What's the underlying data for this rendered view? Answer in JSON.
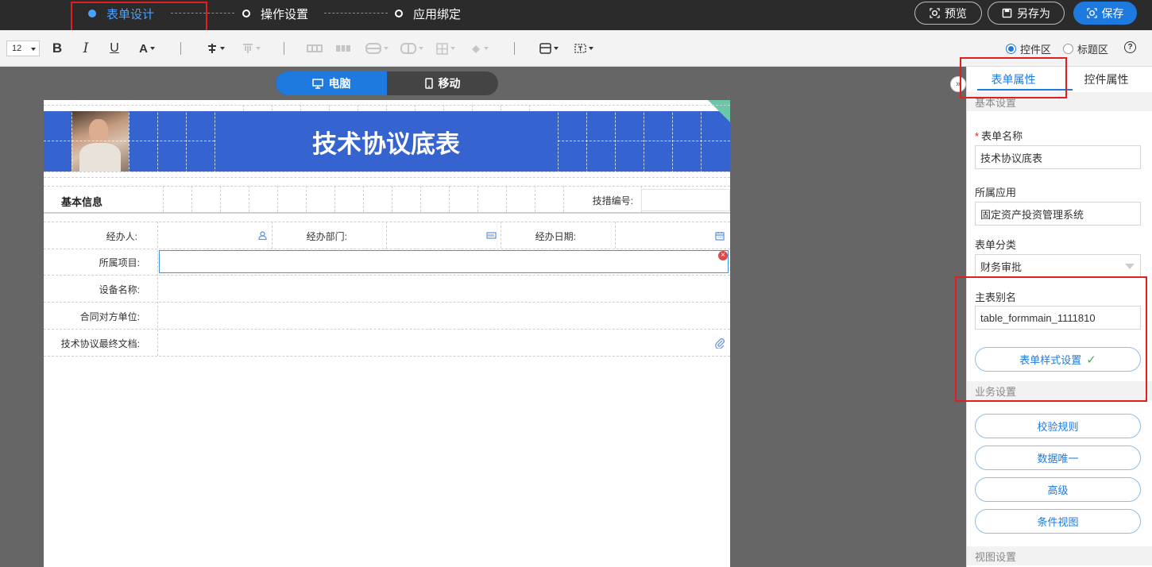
{
  "steps": [
    {
      "label": "表单设计",
      "active": true
    },
    {
      "label": "操作设置",
      "active": false
    },
    {
      "label": "应用绑定",
      "active": false
    }
  ],
  "top_actions": {
    "preview": "预览",
    "save_as": "另存为",
    "save": "保存"
  },
  "toolbar": {
    "font_size": "12",
    "bold": "B",
    "italic": "I",
    "underline": "U",
    "font_color": "A",
    "area_options": [
      {
        "label": "控件区",
        "selected": true
      },
      {
        "label": "标题区",
        "selected": false
      }
    ],
    "help": "?"
  },
  "device_toggle": {
    "desktop": "电脑",
    "mobile": "移动",
    "selected": "电脑"
  },
  "form": {
    "title": "技术协议底表",
    "section_title": "基本信息",
    "serial_label": "技措编号:",
    "fields": {
      "handler": "经办人:",
      "dept": "经办部门:",
      "date": "经办日期:",
      "project": "所属项目:",
      "equipment": "设备名称:",
      "counterparty": "合同对方单位:",
      "final_doc": "技术协议最终文档:"
    }
  },
  "panel": {
    "tabs": [
      {
        "label": "表单属性",
        "active": true
      },
      {
        "label": "控件属性",
        "active": false
      }
    ],
    "basic_section": "基本设置",
    "form_name_label": "表单名称",
    "form_name_value": "技术协议底表",
    "app_label": "所属应用",
    "app_value": "固定资产投资管理系统",
    "category_label": "表单分类",
    "category_value": "财务审批",
    "alias_label": "主表别名",
    "alias_value": "table_formmain_1111810",
    "style_button": "表单样式设置",
    "business_section": "业务设置",
    "business_buttons": [
      "校验规则",
      "数据唯一",
      "高级",
      "条件视图"
    ],
    "view_section": "视图设置"
  },
  "colors": {
    "accent": "#1f7ae0",
    "banner": "#3563d0",
    "highlight": "#e02020"
  }
}
